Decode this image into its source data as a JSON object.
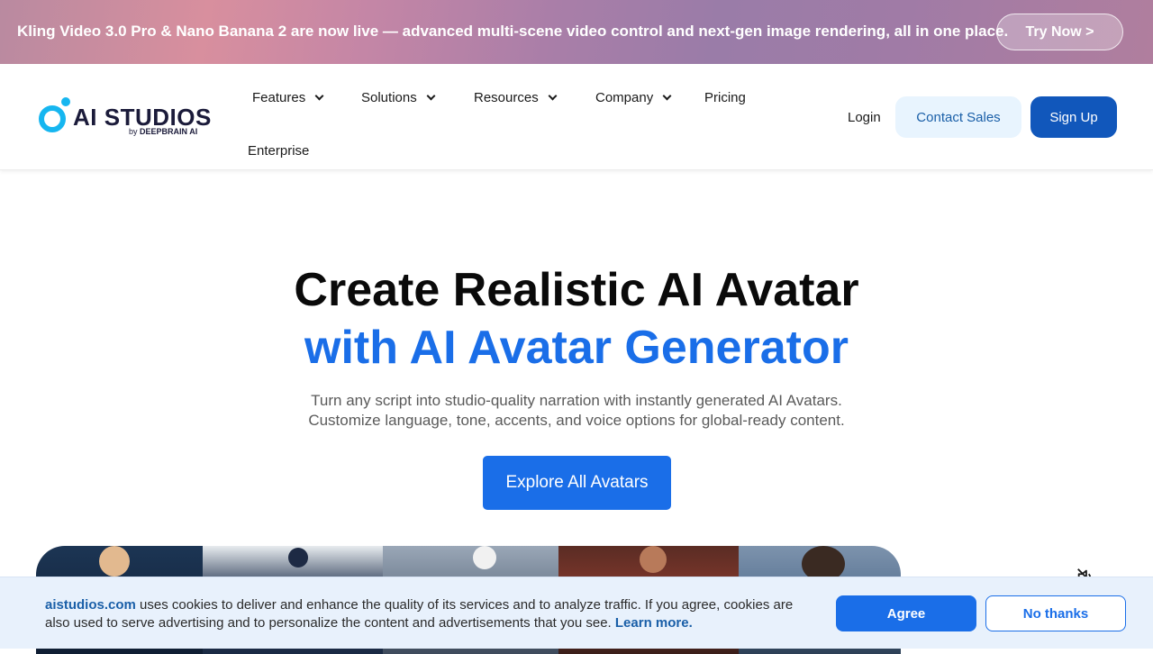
{
  "banner": {
    "text": "Kling Video 3.0 Pro & Nano Banana 2 are now live — advanced multi-scene video control and next-gen image rendering, all in one place.",
    "cta": "Try Now >"
  },
  "header": {
    "logo": {
      "word": "AI STUDIOS",
      "by": "by",
      "brand": "DEEPBRAIN AI"
    },
    "nav": [
      {
        "label": "Features",
        "has_dropdown": true
      },
      {
        "label": "Solutions",
        "has_dropdown": true
      },
      {
        "label": "Resources",
        "has_dropdown": true
      },
      {
        "label": "Company",
        "has_dropdown": true
      },
      {
        "label": "Pricing",
        "has_dropdown": false
      },
      {
        "label": "Enterprise",
        "has_dropdown": false
      }
    ],
    "login": "Login",
    "contact_sales": "Contact Sales",
    "sign_up": "Sign Up"
  },
  "hero": {
    "title_line1": "Create Realistic AI Avatar",
    "title_line2": "with AI Avatar Generator",
    "subtitle_line1": "Turn any script into studio-quality narration with instantly generated AI Avatars.",
    "subtitle_line2": "Customize language, tone, accents, and voice options for global-ready content.",
    "cta": "Explore All Avatars"
  },
  "video": {
    "mute_icon": "speaker-muted-icon"
  },
  "cookie": {
    "site": "aistudios.com",
    "text": " uses cookies to deliver and enhance the quality of its services and to analyze traffic. If you agree, cookies are also used to serve advertising and to personalize the content and advertisements that you see. ",
    "learn_more": "Learn more.",
    "agree": "Agree",
    "no_thanks": "No thanks"
  },
  "colors": {
    "accent": "#1a6ee8",
    "brand_cyan": "#16b6f0",
    "sign_up_bg": "#1157bb",
    "contact_bg": "#e8f4fe"
  }
}
